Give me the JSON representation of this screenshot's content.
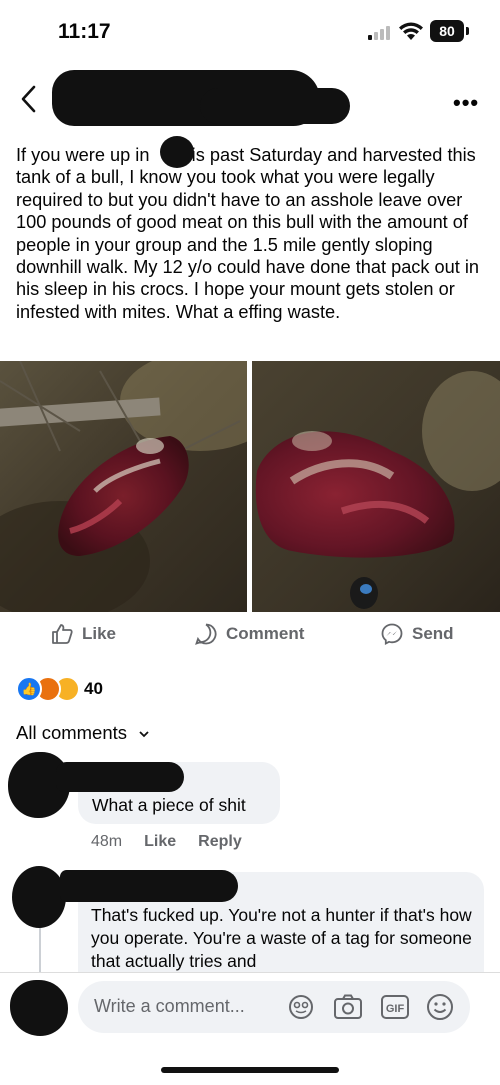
{
  "status_bar": {
    "time": "11:17",
    "battery": "80",
    "battery_icon": "battery-icon",
    "wifi_icon": "wifi-icon",
    "signal_icon": "signal-icon"
  },
  "header": {
    "back_icon": "chevron-left-icon",
    "more_icon": "more-icon"
  },
  "post": {
    "text_part1": "If you were up in",
    "text_part2": " this past Saturday and harvested this tank of a bull, I know you took what you were legally required to but you didn't have to an asshole leave over 100 pounds of good meat on this bull with the amount of people in your group and the 1.5 mile gently sloping downhill walk. My 12 y/o could have done that pack out in his sleep in his crocs. I hope your mount gets stolen or infested with mites. What a effing waste."
  },
  "actions": {
    "like": "Like",
    "comment": "Comment",
    "send": "Send"
  },
  "reactions": {
    "count": "40",
    "colors": {
      "like": "#1877f2",
      "angry": "#e9710f",
      "sad": "#f7b125"
    }
  },
  "comments_header": {
    "label": "All comments"
  },
  "comments": [
    {
      "text": "What a piece of shit",
      "time": "48m",
      "like": "Like",
      "reply": "Reply"
    },
    {
      "text": "That's fucked up. You're not a hunter if that's how you operate. You're a waste of a tag for someone that actually tries and"
    }
  ],
  "composer": {
    "placeholder": "Write a comment...",
    "gif": "GIF"
  }
}
